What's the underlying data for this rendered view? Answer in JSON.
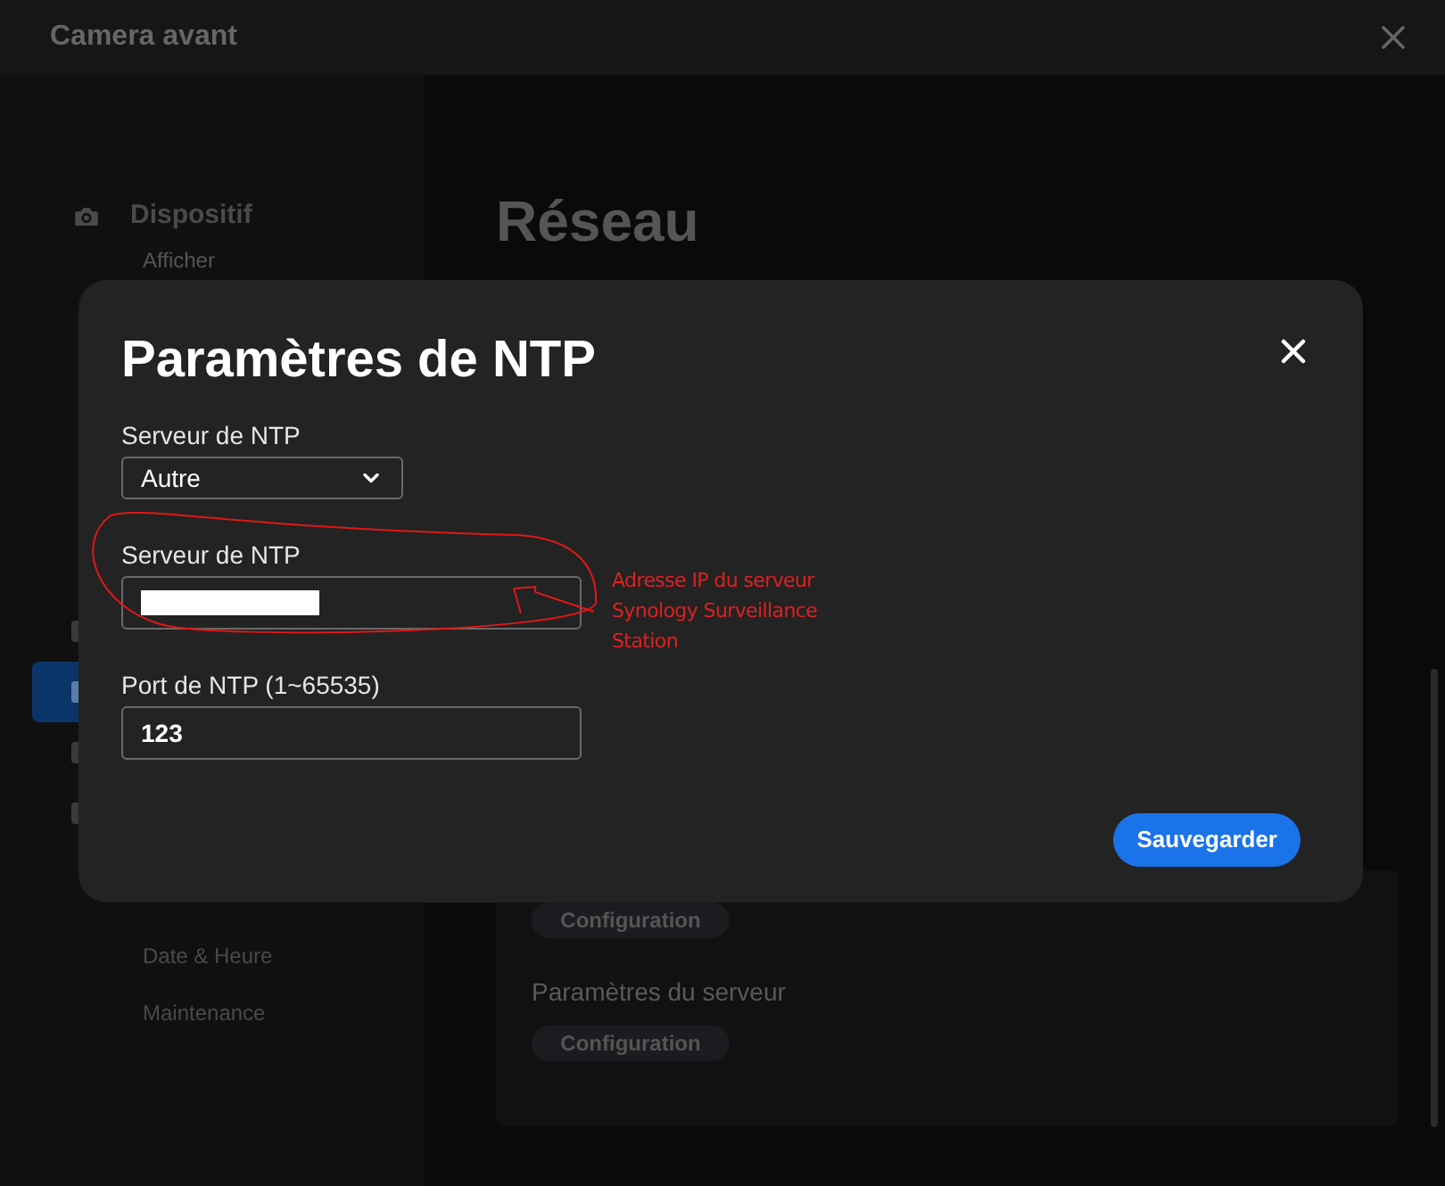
{
  "window": {
    "title": "Camera avant"
  },
  "sidebar": {
    "group": "Dispositif",
    "peek_item": "Afficher",
    "items": [
      {
        "selected": false
      },
      {
        "selected": true
      },
      {
        "selected": false
      },
      {
        "selected": false
      }
    ],
    "bottom_items": [
      "Date & Heure",
      "Maintenance"
    ]
  },
  "main": {
    "title": "Réseau",
    "sections": [
      {
        "button": "Configuration"
      },
      {
        "label": "Paramètres du serveur",
        "button": "Configuration"
      }
    ]
  },
  "dialog": {
    "title": "Paramètres de NTP",
    "fields": [
      {
        "kind": "select",
        "label": "Serveur de NTP",
        "value": "Autre"
      },
      {
        "kind": "redacted",
        "label": "Serveur de NTP"
      },
      {
        "kind": "text",
        "label": "Port de NTP (1~65535)",
        "value": "123"
      }
    ],
    "save_button": "Sauvegarder"
  },
  "annotation": {
    "text": "Adresse IP du serveur Synology Surveillance Station"
  }
}
